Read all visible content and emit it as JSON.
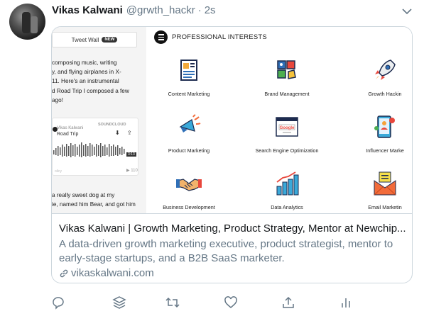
{
  "tweet": {
    "author_name": "Vikas Kalwani",
    "handle": "@grwth_hackr",
    "separator": "·",
    "time": "2s"
  },
  "card": {
    "tweet_wall": {
      "label": "Tweet Wall",
      "badge": "NEW",
      "text_lines": [
        "composing music, writing",
        "y, and flying airplanes in X-",
        "11. Here's an instrumental",
        "d Road Trip I composed a few",
        "ago!"
      ],
      "soundcloud": {
        "brand": "SOUNDCLOUD",
        "user": "Vikas Kalwani",
        "track": "Road Trip",
        "duration": "3:13",
        "privacy": "olicy",
        "plays": "▶ 110"
      },
      "text_lines_2": [
        "a really sweet dog at my",
        "ie, named him Bear, and got him"
      ]
    },
    "interests": {
      "heading": "PROFESSIONAL INTERESTS",
      "items": [
        {
          "label": "Content Marketing",
          "icon": "newspaper-icon"
        },
        {
          "label": "Brand Management",
          "icon": "brand-puzzle-icon"
        },
        {
          "label": "Growth Hackin",
          "icon": "rocket-icon"
        },
        {
          "label": "Product Marketing",
          "icon": "megaphone-icon"
        },
        {
          "label": "Search Engine Optimization",
          "icon": "google-browser-icon"
        },
        {
          "label": "Influencer Marke",
          "icon": "phone-influencer-icon"
        },
        {
          "label": "Business Development",
          "icon": "handshake-icon"
        },
        {
          "label": "Data Analytics",
          "icon": "bar-chart-icon"
        },
        {
          "label": "Email Marketin",
          "icon": "envelope-icon"
        }
      ],
      "google_text": "Google"
    },
    "title": "Vikas Kalwani | Growth Marketing, Product Strategy, Mentor at Newchip...",
    "description": "A data-driven growth marketing executive, product strategist, mentor to early-stage startups, and a B2B SaaS marketer.",
    "link": "vikaskalwani.com"
  },
  "colors": {
    "text_primary": "#14171a",
    "text_secondary": "#657786",
    "border": "#ccd6dd",
    "icon_gray": "#657786"
  },
  "actions": [
    "reply-icon",
    "layers-icon",
    "retweet-icon",
    "like-icon",
    "share-icon",
    "analytics-icon"
  ]
}
